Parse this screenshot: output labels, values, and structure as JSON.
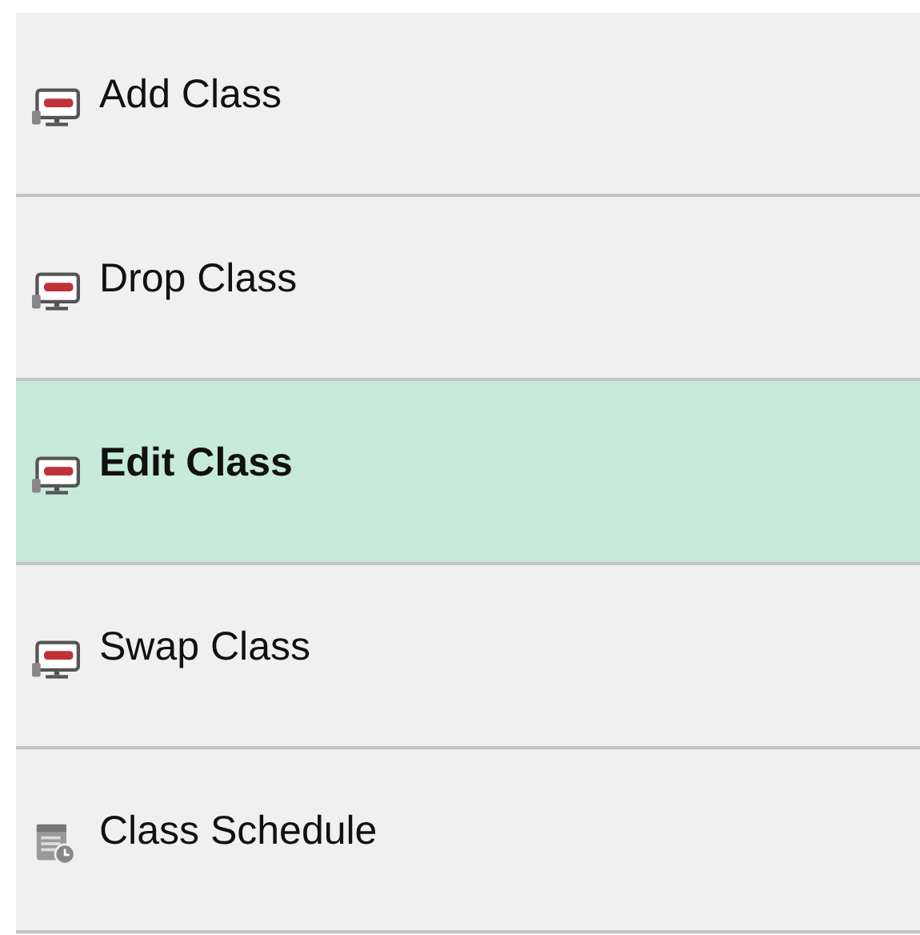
{
  "menu": {
    "items": [
      {
        "label": "Add Class",
        "kind": "monitor",
        "selected": false
      },
      {
        "label": "Drop Class",
        "kind": "monitor",
        "selected": false
      },
      {
        "label": "Edit Class",
        "kind": "monitor",
        "selected": true
      },
      {
        "label": "Swap Class",
        "kind": "monitor",
        "selected": false
      },
      {
        "label": "Class Schedule",
        "kind": "schedule",
        "selected": false
      }
    ]
  }
}
